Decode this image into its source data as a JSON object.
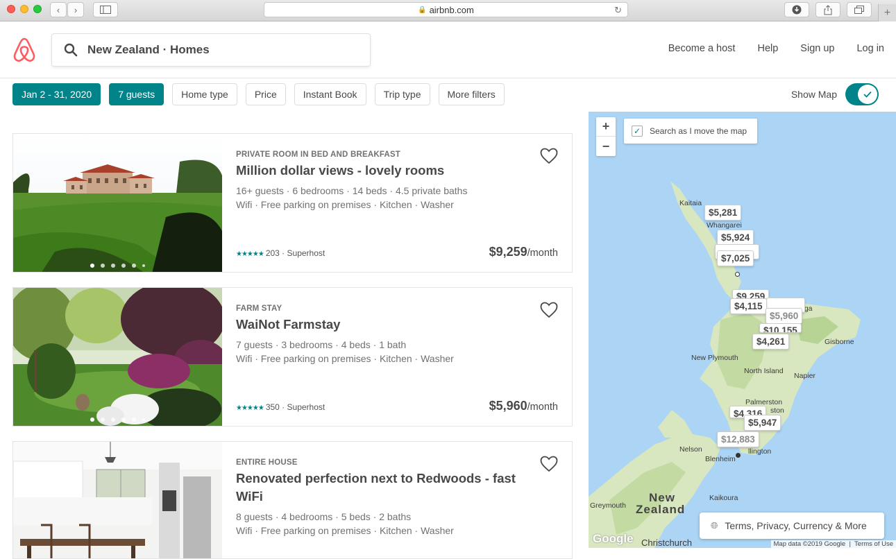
{
  "browser": {
    "url": "airbnb.com"
  },
  "header": {
    "search_value": "New Zealand · Homes",
    "nav": [
      "Become a host",
      "Help",
      "Sign up",
      "Log in"
    ]
  },
  "filters": {
    "items": [
      "Jan 2 - 31, 2020",
      "7 guests",
      "Home type",
      "Price",
      "Instant Book",
      "Trip type",
      "More filters"
    ],
    "show_map_label": "Show Map"
  },
  "listings": [
    {
      "kind": "PRIVATE ROOM IN BED AND BREAKFAST",
      "title": "Million dollar views - lovely rooms",
      "details": "16+ guests · 6 bedrooms · 14 beds · 4.5 private baths",
      "amenities": "Wifi · Free parking on premises · Kitchen · Washer",
      "stars": "★★★★★",
      "reviews": "203 · Superhost",
      "price": "$9,259",
      "price_unit": "/month"
    },
    {
      "kind": "FARM STAY",
      "title": "WaiNot Farmstay",
      "details": "7 guests · 3 bedrooms · 4 beds · 1 bath",
      "amenities": "Wifi · Free parking on premises · Kitchen · Washer",
      "stars": "★★★★★",
      "reviews": "350 · Superhost",
      "price": "$5,960",
      "price_unit": "/month"
    },
    {
      "kind": "ENTIRE HOUSE",
      "title": "Renovated perfection next to Redwoods - fast WiFi",
      "details": "8 guests · 4 bedrooms · 5 beds · 2 baths",
      "amenities": "Wifi · Free parking on premises · Kitchen · Washer"
    }
  ],
  "map": {
    "search_as_move": "Search as I move the map",
    "zoom_in": "+",
    "zoom_out": "−",
    "markers": [
      "$5,281",
      "$5,924",
      "$7,025",
      "$9,259",
      "$4,115",
      "$5,960",
      "$10,155",
      "$4,261",
      "$4,316",
      "$5,947",
      "$12,883"
    ],
    "places": [
      "Kaitaia",
      "Whangarei",
      "New Plymouth",
      "North Island",
      "Napier",
      "Gisborne",
      "Palmerston",
      "Nelson",
      "Blenheim",
      "Kaikoura",
      "Greymouth",
      "New",
      "Zealand",
      "Christchurch",
      "nga",
      "ston",
      "llington"
    ],
    "terms": "Terms, Privacy, Currency & More",
    "attribution": "Map data ©2019 Google",
    "terms_of_use": "Terms of Use",
    "google": "Google"
  },
  "colors": {
    "brand": "#FF5A5F",
    "accent": "#008489"
  }
}
